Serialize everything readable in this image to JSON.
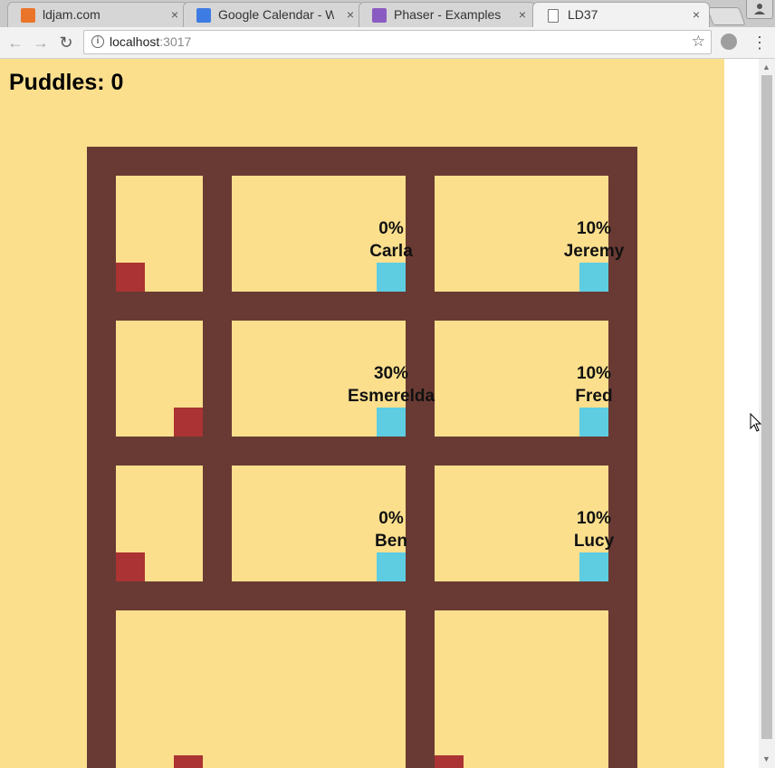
{
  "browser": {
    "tabs": [
      {
        "title": "ldjam.com",
        "favicon_color": "#e9742a",
        "active": false
      },
      {
        "title": "Google Calendar - W",
        "favicon_color": "#3d7ce3",
        "active": false
      },
      {
        "title": "Phaser - Examples",
        "favicon_color": "#8a5cc2",
        "active": false
      },
      {
        "title": "LD37",
        "favicon_color": "#ffffff",
        "active": true
      }
    ],
    "close_glyph": "×",
    "url_host": "localhost",
    "url_port": ":3017",
    "star_glyph": "☆"
  },
  "game": {
    "score_label": "Puddles: 0",
    "colors": {
      "background": "#fbdf8d",
      "wall": "#683a33",
      "puddle": "#ab3333",
      "person": "#5ecde2"
    },
    "people": [
      {
        "name": "Carla",
        "percent": "0%"
      },
      {
        "name": "Jeremy",
        "percent": "10%"
      },
      {
        "name": "Esmerelda",
        "percent": "30%"
      },
      {
        "name": "Fred",
        "percent": "10%"
      },
      {
        "name": "Ben",
        "percent": "0%"
      },
      {
        "name": "Lucy",
        "percent": "10%"
      }
    ]
  }
}
